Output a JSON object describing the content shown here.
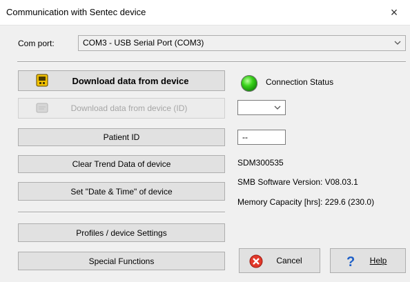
{
  "window": {
    "title": "Communication with Sentec device",
    "close_glyph": "×"
  },
  "com_port": {
    "label": "Com port:",
    "selected": "COM3 - USB Serial Port (COM3)"
  },
  "buttons": {
    "download": "Download data from device",
    "download_id": "Download data from device (ID)",
    "patient_id": "Patient ID",
    "clear_trend": "Clear Trend Data of device",
    "set_datetime": "Set \"Date & Time\" of device",
    "profiles": "Profiles / device Settings",
    "special": "Special Functions",
    "cancel": "Cancel",
    "help": "Help"
  },
  "status": {
    "connection_label": "Connection Status",
    "led_color": "#2fc41a"
  },
  "id_select": {
    "value": ""
  },
  "patient_id_field": {
    "value": "--"
  },
  "device_info": {
    "serial": "SDM300535",
    "software_version": "SMB Software Version: V08.03.1",
    "memory_capacity": "Memory Capacity [hrs]: 229.6 (230.0)"
  },
  "icons": {
    "download": "download-device-icon",
    "download_id": "download-id-icon",
    "cancel": "cancel-icon",
    "help": "help-icon"
  }
}
